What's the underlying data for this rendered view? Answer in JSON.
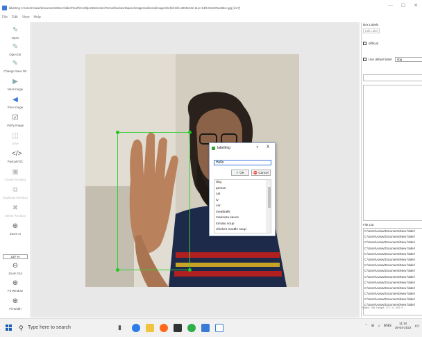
{
  "window": {
    "title": "labelImg C:\\Users\\Aarav\\Documents\\New folder\\RealTimeObjectDetection\\Tensorflow\\workspace\\images\\collectedimages\\hello\\Hello.3205c48e-11ec-b4f5-84e675ca9bcc.jpg [1/47]",
    "min": "—",
    "max": "☐",
    "close": "✕"
  },
  "menu": [
    "File",
    "Edit",
    "View",
    "Help"
  ],
  "toolbar": {
    "open": "Open",
    "open_dir": "Open Dir",
    "change_save_dir": "Change Save Dir",
    "next_image": "Next Image",
    "prev_image": "Prev Image",
    "verify_image": "Verify Image",
    "save": "Save",
    "pascal_voc": "PascalVOC",
    "create_rectbox": "Create RectBox",
    "duplicate_rectbox": "Duplicate RectBox",
    "delete_rectbox": "Delete RectBox",
    "zoom_in": "Zoom In",
    "zoom_level": "137 %",
    "zoom_out": "Zoom Out",
    "fit_window": "Fit Window",
    "fit_width": "Fit Width"
  },
  "dialog": {
    "title": "labelImg",
    "help": "?",
    "close": "X",
    "input_value": "Hello",
    "ok": "OK",
    "cancel": "Cancel",
    "labels": [
      "dog",
      "person",
      "cat",
      "tv",
      "car",
      "meatballs",
      "marinara sauce",
      "tomato soup",
      "chicken noodle soup"
    ]
  },
  "right_panel": {
    "box_labels_title": "Box Labels",
    "edit_label": "Edit Label",
    "difficult": "difficult",
    "use_default_label": "Use default label",
    "default_label_value": "dog",
    "file_list_title": "File List",
    "files": [
      "C:\\Users\\Aarav\\Documents\\New folder\\",
      "C:\\Users\\Aarav\\Documents\\New folder\\",
      "C:\\Users\\Aarav\\Documents\\New folder\\",
      "C:\\Users\\Aarav\\Documents\\New folder\\",
      "C:\\Users\\Aarav\\Documents\\New folder\\",
      "C:\\Users\\Aarav\\Documents\\New folder\\",
      "C:\\Users\\Aarav\\Documents\\New folder\\",
      "C:\\Users\\Aarav\\Documents\\New folder\\",
      "C:\\Users\\Aarav\\Documents\\New folder\\",
      "C:\\Users\\Aarav\\Documents\\New folder\\",
      "C:\\Users\\Aarav\\Documents\\New folder\\",
      "C:\\Users\\Aarav\\Documents\\New folder\\",
      "C:\\Users\\Aarav\\Documents\\New folder\\",
      "C:\\Users\\Aarav\\Documents\\New folder\\"
    ],
    "status": "Width: 798, Height: 772 / X: 340; Y: ..."
  },
  "taskbar": {
    "search_placeholder": "Type here to search",
    "language": "ENG",
    "time": "11:10",
    "date": "26-04-2022"
  },
  "colors": {
    "bbox": "#35d135",
    "accent": "#3a7bd5"
  }
}
